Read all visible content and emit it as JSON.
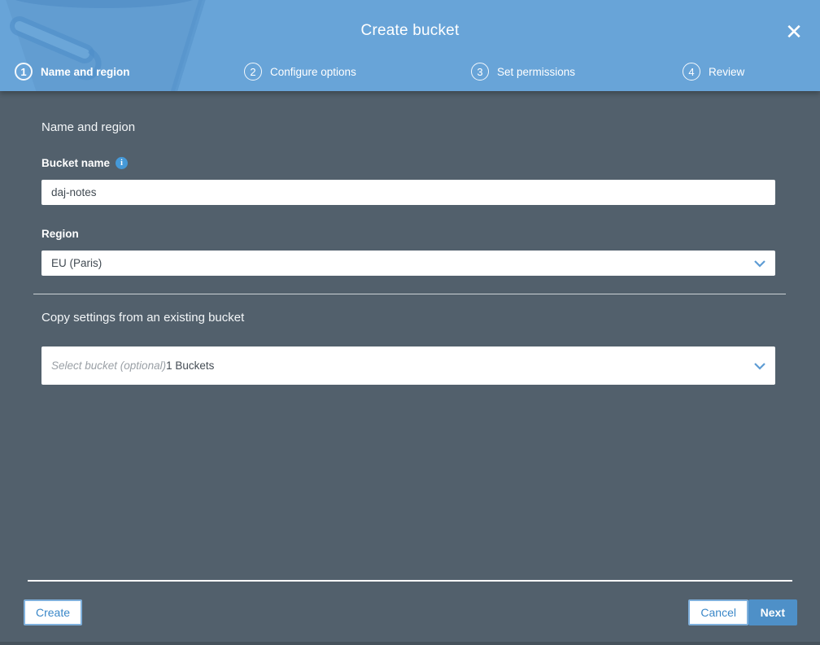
{
  "header": {
    "title": "Create bucket",
    "close_icon": "✕",
    "steps": [
      {
        "number": "1",
        "label": "Name and region"
      },
      {
        "number": "2",
        "label": "Configure options"
      },
      {
        "number": "3",
        "label": "Set permissions"
      },
      {
        "number": "4",
        "label": "Review"
      }
    ]
  },
  "form": {
    "section_title": "Name and region",
    "bucket_name": {
      "label": "Bucket name",
      "info_icon": "i",
      "value": "daj-notes"
    },
    "region": {
      "label": "Region",
      "selected": "EU (Paris)"
    },
    "copy_settings": {
      "section_title": "Copy settings from an existing bucket",
      "placeholder": "Select bucket (optional)",
      "count_text": "1 Buckets"
    }
  },
  "footer": {
    "create_label": "Create",
    "cancel_label": "Cancel",
    "next_label": "Next"
  },
  "colors": {
    "header_blue": "#68a4d8",
    "body_slate": "#52606c",
    "accent_blue": "#3a87c8",
    "primary_button_blue": "#4e90c8"
  }
}
